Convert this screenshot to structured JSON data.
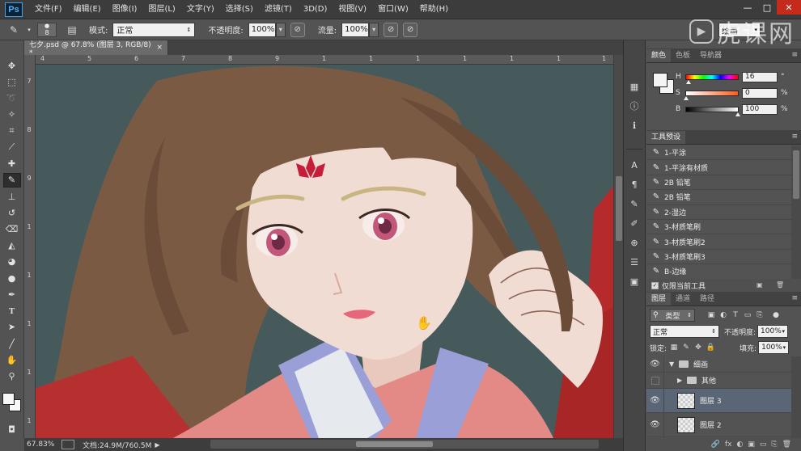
{
  "menubar": {
    "logo": "Ps",
    "items": [
      "文件(F)",
      "编辑(E)",
      "图像(I)",
      "图层(L)",
      "文字(Y)",
      "选择(S)",
      "滤镜(T)",
      "3D(D)",
      "视图(V)",
      "窗口(W)",
      "帮助(H)"
    ],
    "window_controls": [
      "—",
      "□",
      "✕"
    ]
  },
  "watermark": {
    "logo": "▶",
    "text": "虎课网"
  },
  "options": {
    "brush_size": "8",
    "mode_label": "模式:",
    "mode_value": "正常",
    "opacity_label": "不透明度:",
    "opacity_value": "100%",
    "flow_label": "流量:",
    "flow_value": "100%",
    "workspace": "绘画"
  },
  "document": {
    "tab_title": "七夕.psd @ 67.8% (图层 3, RGB/8) *",
    "close": "×"
  },
  "ruler": {
    "top": [
      "4",
      "5",
      "6",
      "7",
      "8",
      "9",
      "1",
      "1",
      "1",
      "1",
      "1",
      "1",
      "1"
    ],
    "left": [
      "7",
      "8",
      "9",
      "1",
      "1",
      "1",
      "1",
      "1"
    ]
  },
  "status": {
    "zoom": "67.83%",
    "doc_size": "文档:24.9M/760.5M",
    "arrow": "▶"
  },
  "color_panel": {
    "tabs": [
      "颜色",
      "色板",
      "导航器"
    ],
    "rows": [
      {
        "letter": "H",
        "value": "16",
        "unit": "°"
      },
      {
        "letter": "S",
        "value": "0",
        "unit": "%"
      },
      {
        "letter": "B",
        "value": "100",
        "unit": "%"
      }
    ]
  },
  "presets_panel": {
    "title": "工具预设",
    "items": [
      "1-平涂",
      "1-平涂有材质",
      "2B 铅笔",
      "2B 铅笔",
      "2-湿边",
      "3-材质笔刷",
      "3-材质笔刷2",
      "3-材质笔刷3",
      "B-边缘"
    ],
    "footer_check": "✓",
    "footer_label": "仅限当前工具"
  },
  "layers_panel": {
    "tabs": [
      "图层",
      "通道",
      "路径"
    ],
    "filter_type": "类型",
    "blend_mode": "正常",
    "opacity_label": "不透明度:",
    "opacity_value": "100%",
    "lock_label": "锁定:",
    "fill_label": "填充:",
    "fill_value": "100%",
    "layers": [
      {
        "name": "细画",
        "kind": "group",
        "expanded": true,
        "visible": true
      },
      {
        "name": "其他",
        "kind": "group",
        "expanded": false,
        "visible": false
      },
      {
        "name": "图层 3",
        "kind": "layer",
        "visible": true,
        "selected": true
      },
      {
        "name": "图层 2",
        "kind": "layer",
        "visible": true,
        "selected": false
      }
    ],
    "footer_icons": [
      "🔗",
      "fx",
      "◐",
      "▣",
      "▭",
      "⎘",
      "🗑"
    ]
  },
  "colors": {
    "canvas_bg": "#465a5c",
    "hair": "#7b5a44",
    "skin": "#f1dcd3",
    "kimono_pink": "#e48a86",
    "collar_purple": "#9b9fd8",
    "forehead_mark": "#c41e3a"
  }
}
